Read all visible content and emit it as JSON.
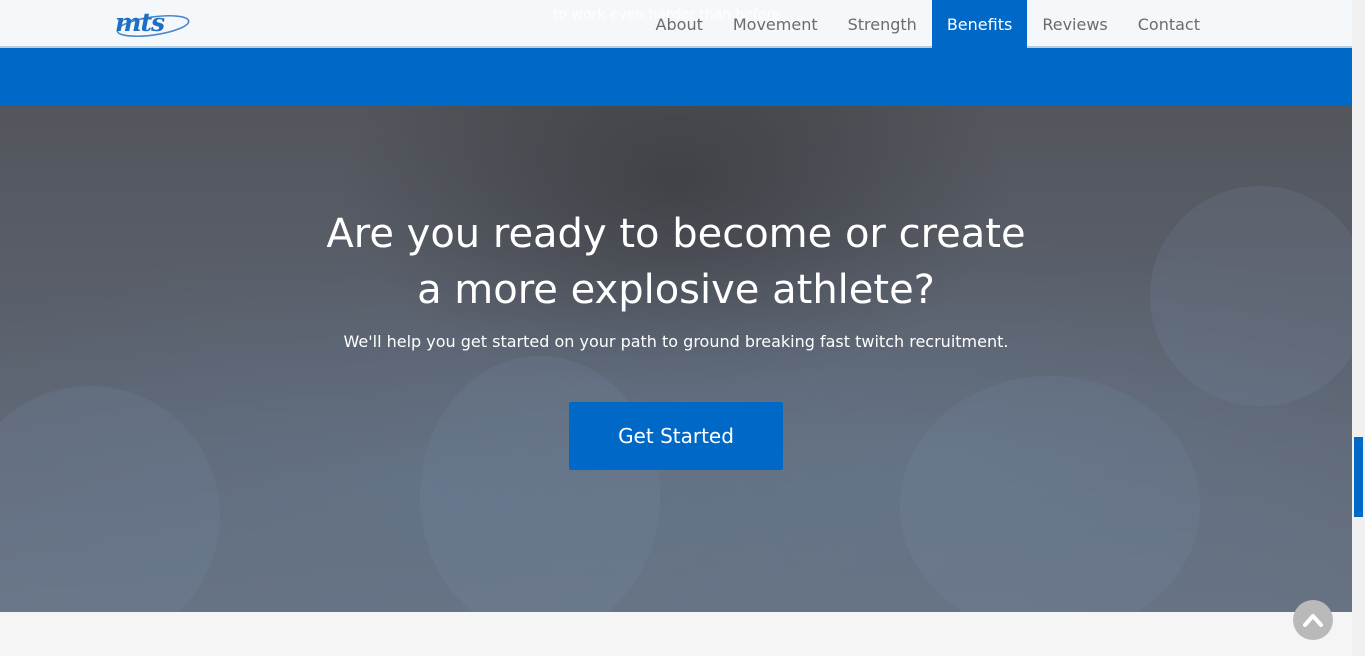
{
  "header": {
    "logo_text": "mts",
    "ghost_text": "to work even harder than before.",
    "nav": [
      {
        "label": "About"
      },
      {
        "label": "Movement"
      },
      {
        "label": "Strength"
      },
      {
        "label": "Benefits",
        "active": true
      },
      {
        "label": "Reviews"
      },
      {
        "label": "Contact"
      }
    ]
  },
  "hero": {
    "title_line1": "Are you ready to become or create",
    "title_line2": "a more explosive athlete?",
    "subtitle": "We'll help you get started on your path to ground breaking fast twitch recruitment.",
    "cta_label": "Get Started"
  },
  "colors": {
    "brand_blue": "#0069c8",
    "back_to_top": "#b9b9b9"
  },
  "icons": {
    "back_to_top": "chevron-up-icon"
  }
}
